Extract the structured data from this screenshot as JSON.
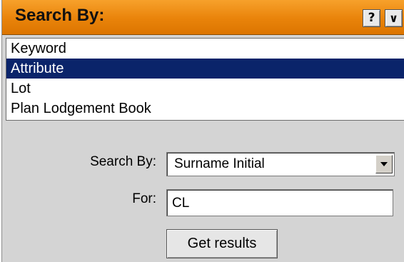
{
  "panel": {
    "title": "Search By:",
    "help_button": "?",
    "collapse_icon": "chevron-down-icon"
  },
  "search_types": [
    {
      "label": "Keyword",
      "selected": false
    },
    {
      "label": "Attribute",
      "selected": true
    },
    {
      "label": "Lot",
      "selected": false
    },
    {
      "label": "Plan Lodgement Book",
      "selected": false
    }
  ],
  "form": {
    "search_by_label": "Search By:",
    "search_by_value": "Surname Initial",
    "for_label": "For:",
    "for_value": "CL",
    "submit_label": "Get results"
  },
  "colors": {
    "header_orange": "#e9830a",
    "selection_navy": "#0a246a",
    "panel_gray": "#d4d4d4"
  }
}
